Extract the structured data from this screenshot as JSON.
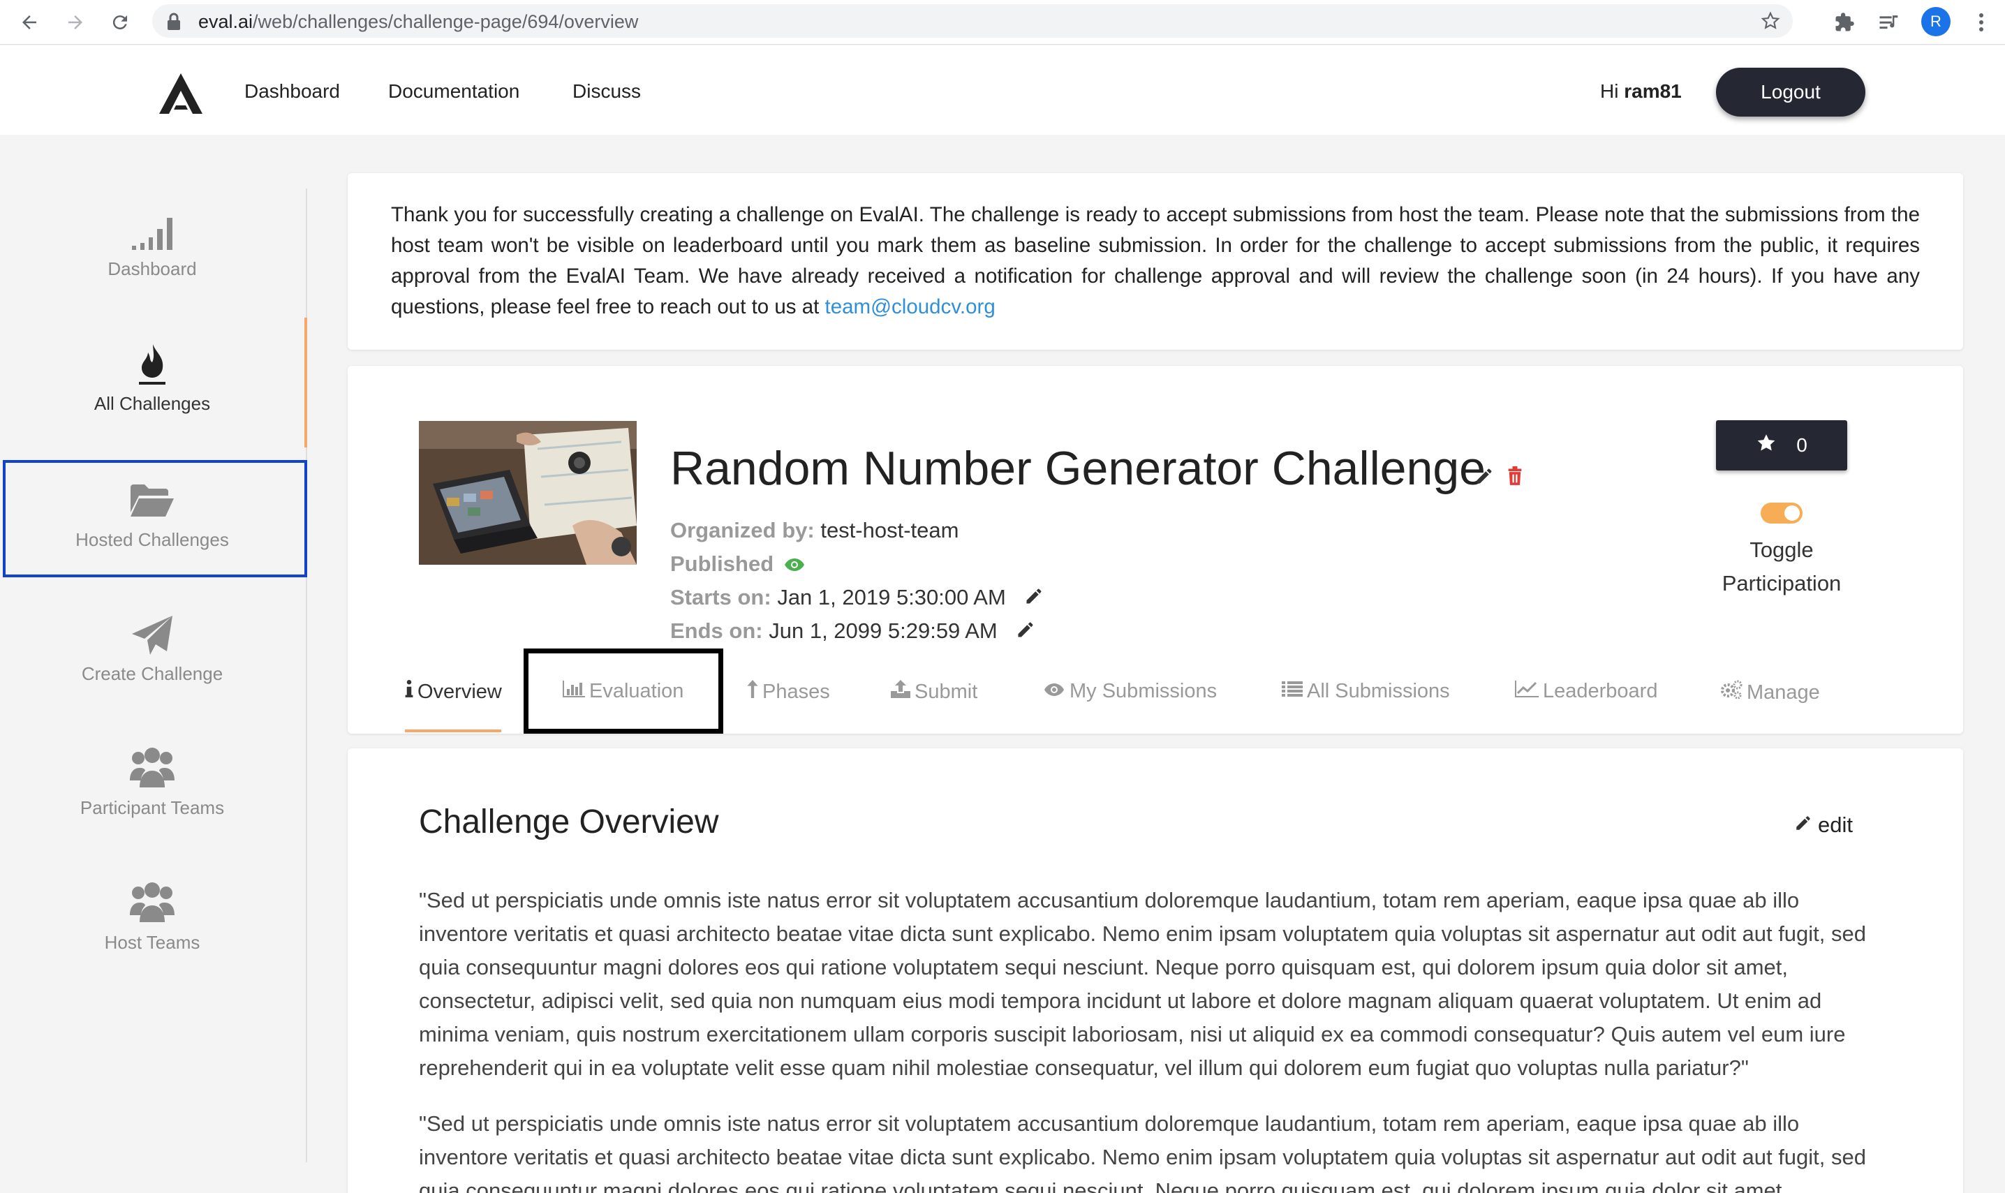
{
  "browser": {
    "url_host": "eval.ai",
    "url_path": "/web/challenges/challenge-page/694/overview",
    "profile_initial": "R"
  },
  "header": {
    "nav": [
      "Dashboard",
      "Documentation",
      "Discuss"
    ],
    "greeting_prefix": "Hi ",
    "username": "ram81",
    "logout_label": "Logout"
  },
  "sidebar": {
    "items": [
      {
        "label": "Dashboard",
        "icon": "signal-bars-icon"
      },
      {
        "label": "All Challenges",
        "icon": "flame-icon"
      },
      {
        "label": "Hosted Challenges",
        "icon": "folder-open-icon"
      },
      {
        "label": "Create Challenge",
        "icon": "paper-plane-icon"
      },
      {
        "label": "Participant Teams",
        "icon": "users-icon"
      },
      {
        "label": "Host Teams",
        "icon": "users-icon"
      }
    ]
  },
  "notice": {
    "text": "Thank you for successfully creating a challenge on EvalAI. The challenge is ready to accept submissions from host the team. Please note that the submissions from the host team won't be visible on leaderboard until you mark them as baseline submission. In order for the challenge to accept submissions from the public, it requires approval from the EvalAI Team. We have already received a notification for challenge approval and will review the challenge soon (in 24 hours). If you have any questions, please feel free to reach out to us at ",
    "email": "team@cloudcv.org"
  },
  "challenge": {
    "title": "Random Number Generator Challenge",
    "organized_by_label": "Organized by:",
    "organized_by": "test-host-team",
    "published_label": "Published",
    "starts_label": "Starts on:",
    "starts_value": "Jan 1, 2019 5:30:00 AM",
    "ends_label": "Ends on:",
    "ends_value": "Jun 1, 2099 5:29:59 AM",
    "star_count": "0",
    "toggle_label": "Toggle Participation"
  },
  "tabs": [
    {
      "label": "Overview",
      "icon": "info-icon",
      "active": true
    },
    {
      "label": "Evaluation",
      "icon": "bar-chart-icon",
      "active": false
    },
    {
      "label": "Phases",
      "icon": "arrow-up-icon",
      "active": false
    },
    {
      "label": "Submit",
      "icon": "upload-icon",
      "active": false
    },
    {
      "label": "My Submissions",
      "icon": "eye-icon",
      "active": false
    },
    {
      "label": "All Submissions",
      "icon": "list-icon",
      "active": false
    },
    {
      "label": "Leaderboard",
      "icon": "line-chart-icon",
      "active": false
    },
    {
      "label": "Manage",
      "icon": "gears-icon",
      "active": false
    }
  ],
  "overview": {
    "title": "Challenge Overview",
    "edit_label": "edit",
    "paragraphs": [
      "\"Sed ut perspiciatis unde omnis iste natus error sit voluptatem accusantium doloremque laudantium, totam rem aperiam, eaque ipsa quae ab illo inventore veritatis et quasi architecto beatae vitae dicta sunt explicabo. Nemo enim ipsam voluptatem quia voluptas sit aspernatur aut odit aut fugit, sed quia consequuntur magni dolores eos qui ratione voluptatem sequi nesciunt. Neque porro quisquam est, qui dolorem ipsum quia dolor sit amet, consectetur, adipisci velit, sed quia non numquam eius modi tempora incidunt ut labore et dolore magnam aliquam quaerat voluptatem. Ut enim ad minima veniam, quis nostrum exercitationem ullam corporis suscipit laboriosam, nisi ut aliquid ex ea commodi consequatur? Quis autem vel eum iure reprehenderit qui in ea voluptate velit esse quam nihil molestiae consequatur, vel illum qui dolorem eum fugiat quo voluptas nulla pariatur?\"",
      "\"Sed ut perspiciatis unde omnis iste natus error sit voluptatem accusantium doloremque laudantium, totam rem aperiam, eaque ipsa quae ab illo inventore veritatis et quasi architecto beatae vitae dicta sunt explicabo. Nemo enim ipsam voluptatem quia voluptas sit aspernatur aut odit aut fugit, sed quia consequuntur magni dolores eos qui ratione voluptatem sequi nesciunt. Neque porro quisquam est, qui dolorem ipsum quia dolor sit amet,"
    ]
  },
  "colors": {
    "accent": "#f8a66a",
    "dark_button": "#252833",
    "link": "#2f8fd8",
    "highlight_box": "#1143cc",
    "published_eye": "#4caf50",
    "trash": "#e53935"
  }
}
